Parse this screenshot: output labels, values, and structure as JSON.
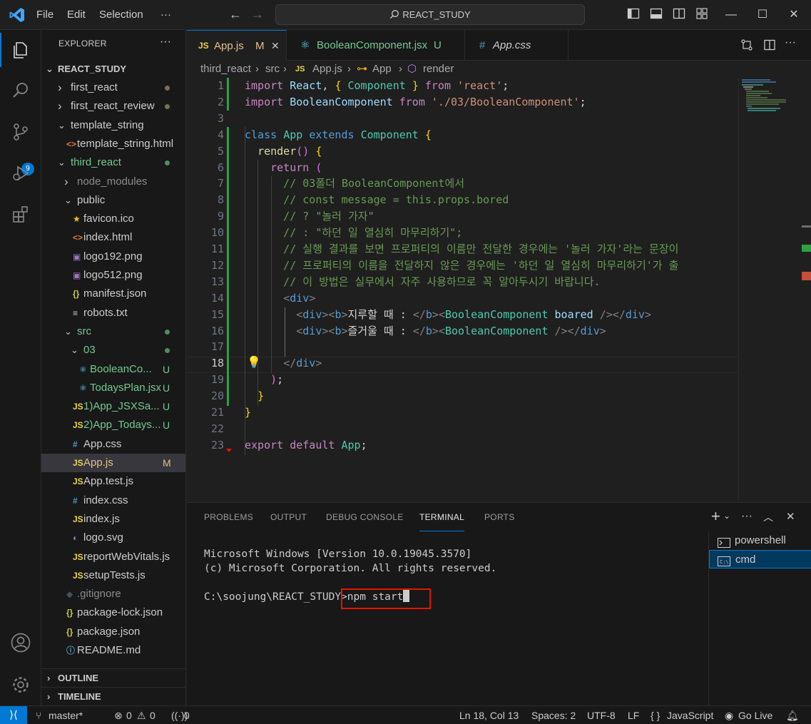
{
  "titlebar": {
    "menus": [
      "File",
      "Edit",
      "Selection",
      "···"
    ],
    "search_text": "REACT_STUDY"
  },
  "activity": {
    "scm_badge": "9"
  },
  "sidebar": {
    "title": "EXPLORER",
    "more": "···",
    "root": "REACT_STUDY",
    "tree": [
      {
        "label": "first_react",
        "indent": 1,
        "type": "folder",
        "open": false,
        "status": "dot-gray"
      },
      {
        "label": "first_react_review",
        "indent": 1,
        "type": "folder",
        "open": false,
        "status": "dot-gray"
      },
      {
        "label": "template_string",
        "indent": 1,
        "type": "folder",
        "open": true,
        "status": ""
      },
      {
        "label": "template_string.html",
        "indent": 2,
        "type": "html",
        "status": ""
      },
      {
        "label": "third_react",
        "indent": 1,
        "type": "folder",
        "open": true,
        "status": "dot-green"
      },
      {
        "label": "node_modules",
        "indent": 2,
        "type": "folder",
        "open": false,
        "status": ""
      },
      {
        "label": "public",
        "indent": 2,
        "type": "folder",
        "open": true,
        "status": ""
      },
      {
        "label": "favicon.ico",
        "indent": 3,
        "type": "star",
        "status": ""
      },
      {
        "label": "index.html",
        "indent": 3,
        "type": "html",
        "status": ""
      },
      {
        "label": "logo192.png",
        "indent": 3,
        "type": "img",
        "status": ""
      },
      {
        "label": "logo512.png",
        "indent": 3,
        "type": "img",
        "status": ""
      },
      {
        "label": "manifest.json",
        "indent": 3,
        "type": "json",
        "status": ""
      },
      {
        "label": "robots.txt",
        "indent": 3,
        "type": "txt",
        "status": ""
      },
      {
        "label": "src",
        "indent": 2,
        "type": "folder",
        "open": true,
        "status": "dot-green"
      },
      {
        "label": "03",
        "indent": 3,
        "type": "folder",
        "open": true,
        "status": "dot-green"
      },
      {
        "label": "BooleanCo...",
        "indent": 4,
        "type": "react",
        "status": "U"
      },
      {
        "label": "TodaysPlan.jsx",
        "indent": 4,
        "type": "react",
        "status": "U"
      },
      {
        "label": "1)App_JSXSa...",
        "indent": 3,
        "type": "js",
        "status": "U"
      },
      {
        "label": "2)App_Todays...",
        "indent": 3,
        "type": "js",
        "status": "U"
      },
      {
        "label": "App.css",
        "indent": 3,
        "type": "css",
        "status": ""
      },
      {
        "label": "App.js",
        "indent": 3,
        "type": "js",
        "status": "M",
        "selected": true
      },
      {
        "label": "App.test.js",
        "indent": 3,
        "type": "js",
        "status": ""
      },
      {
        "label": "index.css",
        "indent": 3,
        "type": "css",
        "status": ""
      },
      {
        "label": "index.js",
        "indent": 3,
        "type": "js",
        "status": ""
      },
      {
        "label": "logo.svg",
        "indent": 3,
        "type": "svg",
        "status": ""
      },
      {
        "label": "reportWebVitals.js",
        "indent": 3,
        "type": "js",
        "status": ""
      },
      {
        "label": "setupTests.js",
        "indent": 3,
        "type": "js",
        "status": ""
      },
      {
        "label": ".gitignore",
        "indent": 2,
        "type": "git",
        "status": ""
      },
      {
        "label": "package-lock.json",
        "indent": 2,
        "type": "json",
        "status": ""
      },
      {
        "label": "package.json",
        "indent": 2,
        "type": "json",
        "status": ""
      },
      {
        "label": "README.md",
        "indent": 2,
        "type": "info",
        "status": ""
      }
    ],
    "outline": "OUTLINE",
    "timeline": "TIMELINE"
  },
  "tabs": [
    {
      "icon": "JS",
      "label": "App.js",
      "status": "M",
      "close": "✕",
      "active": true
    },
    {
      "icon": "⚛",
      "label": "BooleanComponent.jsx",
      "status": "U",
      "active": false
    },
    {
      "icon": "#",
      "label": "App.css",
      "status": "",
      "active": false
    }
  ],
  "breadcrumb": [
    "third_react",
    "src",
    "App.js",
    "App",
    "render"
  ],
  "code": {
    "current_line": 18,
    "lines": [
      "import React, { Component } from 'react';",
      "import BooleanComponent from './03/BooleanComponent';",
      "",
      "class App extends Component {",
      "  render() {",
      "    return (",
      "      // 03폴더 BooleanComponent에서",
      "      // const message = this.props.bored",
      "      // ? \"놀러 가자\"",
      "      // : \"하던 일 열심히 마무리하기\";",
      "      // 실행 결과를 보면 프로퍼티의 이름만 전달한 경우에는 '놀러 가자'라는 문장이",
      "      // 프로퍼티의 이름을 전달하지 않은 경우에는 '하던 일 열심히 마무리하기'가 출",
      "      // 이 방법은 실무에서 자주 사용하므로 꼭 알아두시기 바랍니다.",
      "      <div>",
      "        <div><b>지루할 때 : </b><BooleanComponent boared /></div>",
      "        <div><b>즐거울 때 : </b><BooleanComponent /></div>",
      "",
      "      </div>",
      "    );",
      "  }",
      "}",
      "",
      "export default App;"
    ]
  },
  "panel": {
    "tabs": [
      "PROBLEMS",
      "OUTPUT",
      "DEBUG CONSOLE",
      "TERMINAL",
      "PORTS"
    ],
    "active_tab": "TERMINAL",
    "terminal_lines": [
      "Microsoft Windows [Version 10.0.19045.3570]",
      "(c) Microsoft Corporation. All rights reserved.",
      ""
    ],
    "prompt": "C:\\soojung\\REACT_STUDY",
    "command": ">npm start",
    "terminals": [
      "powershell",
      "cmd"
    ],
    "active_terminal": "cmd"
  },
  "statusbar": {
    "branch": "master*",
    "errors": "0",
    "warnings": "0",
    "ports": "0",
    "position": "Ln 18, Col 13",
    "spaces": "Spaces: 2",
    "encoding": "UTF-8",
    "eol": "LF",
    "language": "JavaScript",
    "golive": "Go Live"
  },
  "colors": {
    "accent": "#0078d4",
    "modified": "#e2c08d",
    "untracked": "#73c991",
    "highlight_box": "#e51400"
  }
}
